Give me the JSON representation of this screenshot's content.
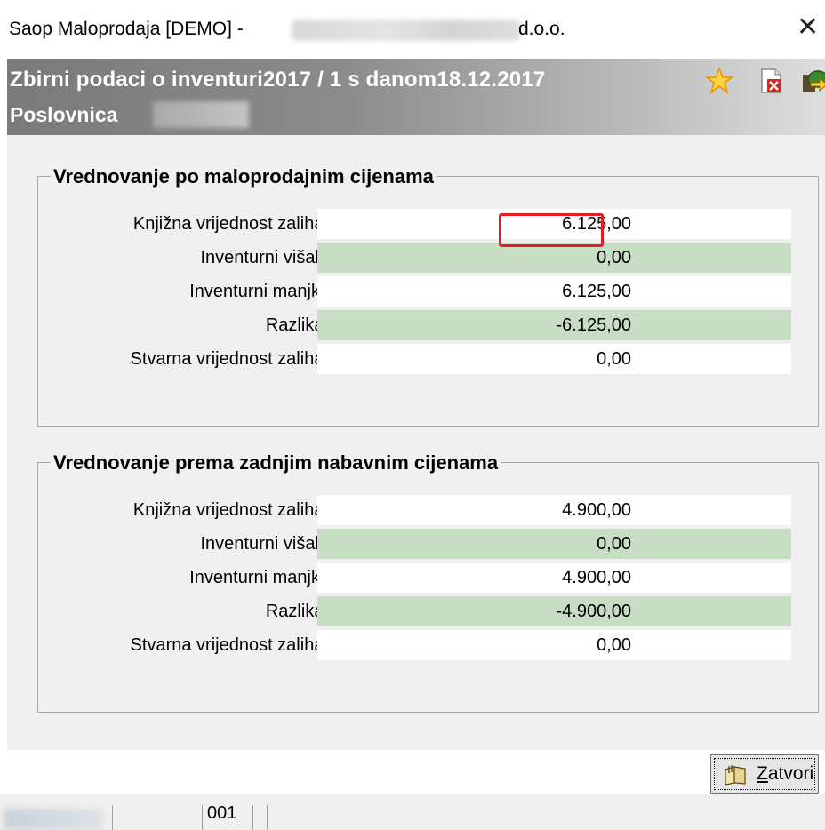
{
  "window": {
    "title": "Saop Maloprodaja [DEMO] -",
    "title_suffix": "d.o.o.",
    "close_symbol": "✕"
  },
  "header": {
    "title": "Zbirni podaci o inventuri2017 / 1 s danom18.12.2017",
    "subtitle": "Poslovnica",
    "icons": [
      "star-icon",
      "pdf-icon",
      "exit-icon"
    ]
  },
  "section_retail": {
    "legend": "Vrednovanje po maloprodajnim cijenama",
    "rows": [
      {
        "label": "Knjižna vrijednost zaliha:",
        "value": "6.125,00"
      },
      {
        "label": "Inventurni višak:",
        "value": "0,00"
      },
      {
        "label": "Inventurni manjki:",
        "value": "6.125,00"
      },
      {
        "label": "Razlika:",
        "value": "-6.125,00"
      },
      {
        "label": "Stvarna vrijednost zaliha:",
        "value": "0,00"
      }
    ]
  },
  "section_purchase": {
    "legend": "Vrednovanje prema zadnjim nabavnim cijenama",
    "rows": [
      {
        "label": "Knjižna vrijednost zaliha:",
        "value": "4.900,00"
      },
      {
        "label": "Inventurni višak:",
        "value": "0,00"
      },
      {
        "label": "Inventurni manjki:",
        "value": "4.900,00"
      },
      {
        "label": "Razlika:",
        "value": "-4.900,00"
      },
      {
        "label": "Stvarna vrijednost zaliha:",
        "value": "0,00"
      }
    ]
  },
  "footer": {
    "close_first_letter": "Z",
    "close_rest": "atvori"
  },
  "statusbar": {
    "code": "001"
  },
  "colors": {
    "alt_row": "#c7dec5",
    "highlight_border": "#e02020",
    "header_gradient_start": "#7a7a7a"
  }
}
